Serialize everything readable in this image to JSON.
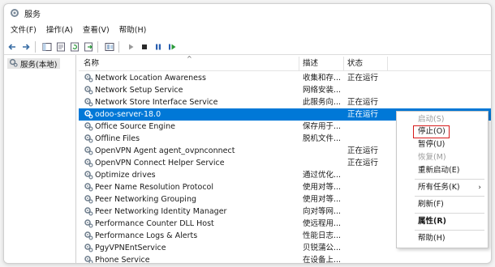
{
  "window": {
    "title": "服务",
    "icon": "services-gear-icon"
  },
  "menu": [
    "文件(F)",
    "操作(A)",
    "查看(V)",
    "帮助(H)"
  ],
  "toolbar": {
    "buttons": [
      "back-arrow-icon",
      "forward-arrow-icon",
      "console-tree-icon",
      "properties-icon",
      "refresh-icon",
      "export-list-icon",
      "help-icon",
      "start-service-icon",
      "stop-service-icon",
      "pause-service-icon",
      "restart-service-icon"
    ]
  },
  "tree": {
    "item_label": "服务(本地)"
  },
  "columns": {
    "name": "名称",
    "desc": "描述",
    "status": "状态"
  },
  "services": [
    {
      "name": "Network Location Awareness",
      "desc": "收集和存...",
      "status": "正在运行"
    },
    {
      "name": "Network Setup Service",
      "desc": "网络安装...",
      "status": ""
    },
    {
      "name": "Network Store Interface Service",
      "desc": "此服务向...",
      "status": "正在运行"
    },
    {
      "name": "odoo-server-18.0",
      "desc": "",
      "status": "正在运行",
      "selected": true
    },
    {
      "name": "Office  Source Engine",
      "desc": "保存用于...",
      "status": ""
    },
    {
      "name": "Offline Files",
      "desc": "脱机文件...",
      "status": ""
    },
    {
      "name": "OpenVPN Agent agent_ovpnconnect",
      "desc": "",
      "status": "正在运行"
    },
    {
      "name": "OpenVPN Connect Helper Service",
      "desc": "",
      "status": "正在运行"
    },
    {
      "name": "Optimize drives",
      "desc": "通过优化...",
      "status": ""
    },
    {
      "name": "Peer Name Resolution Protocol",
      "desc": "使用对等...",
      "status": ""
    },
    {
      "name": "Peer Networking Grouping",
      "desc": "使用对等...",
      "status": ""
    },
    {
      "name": "Peer Networking Identity Manager",
      "desc": "向对等网...",
      "status": ""
    },
    {
      "name": "Performance Counter DLL Host",
      "desc": "使远程用...",
      "status": ""
    },
    {
      "name": "Performance Logs & Alerts",
      "desc": "性能日志...",
      "status": ""
    },
    {
      "name": "PgyVPNEntService",
      "desc": "贝锐蒲公...",
      "status": ""
    },
    {
      "name": "Phone Service",
      "desc": "在设备上...",
      "status": ""
    }
  ],
  "context_menu": {
    "start": "启动(S)",
    "stop": "停止(O)",
    "pause": "暂停(U)",
    "resume": "恢复(M)",
    "restart": "重新启动(E)",
    "all_tasks": "所有任务(K)",
    "refresh": "刷新(F)",
    "properties": "属性(R)",
    "help": "帮助(H)",
    "highlight_color": "#d71a1a"
  },
  "colors": {
    "selection": "#0078d7"
  }
}
